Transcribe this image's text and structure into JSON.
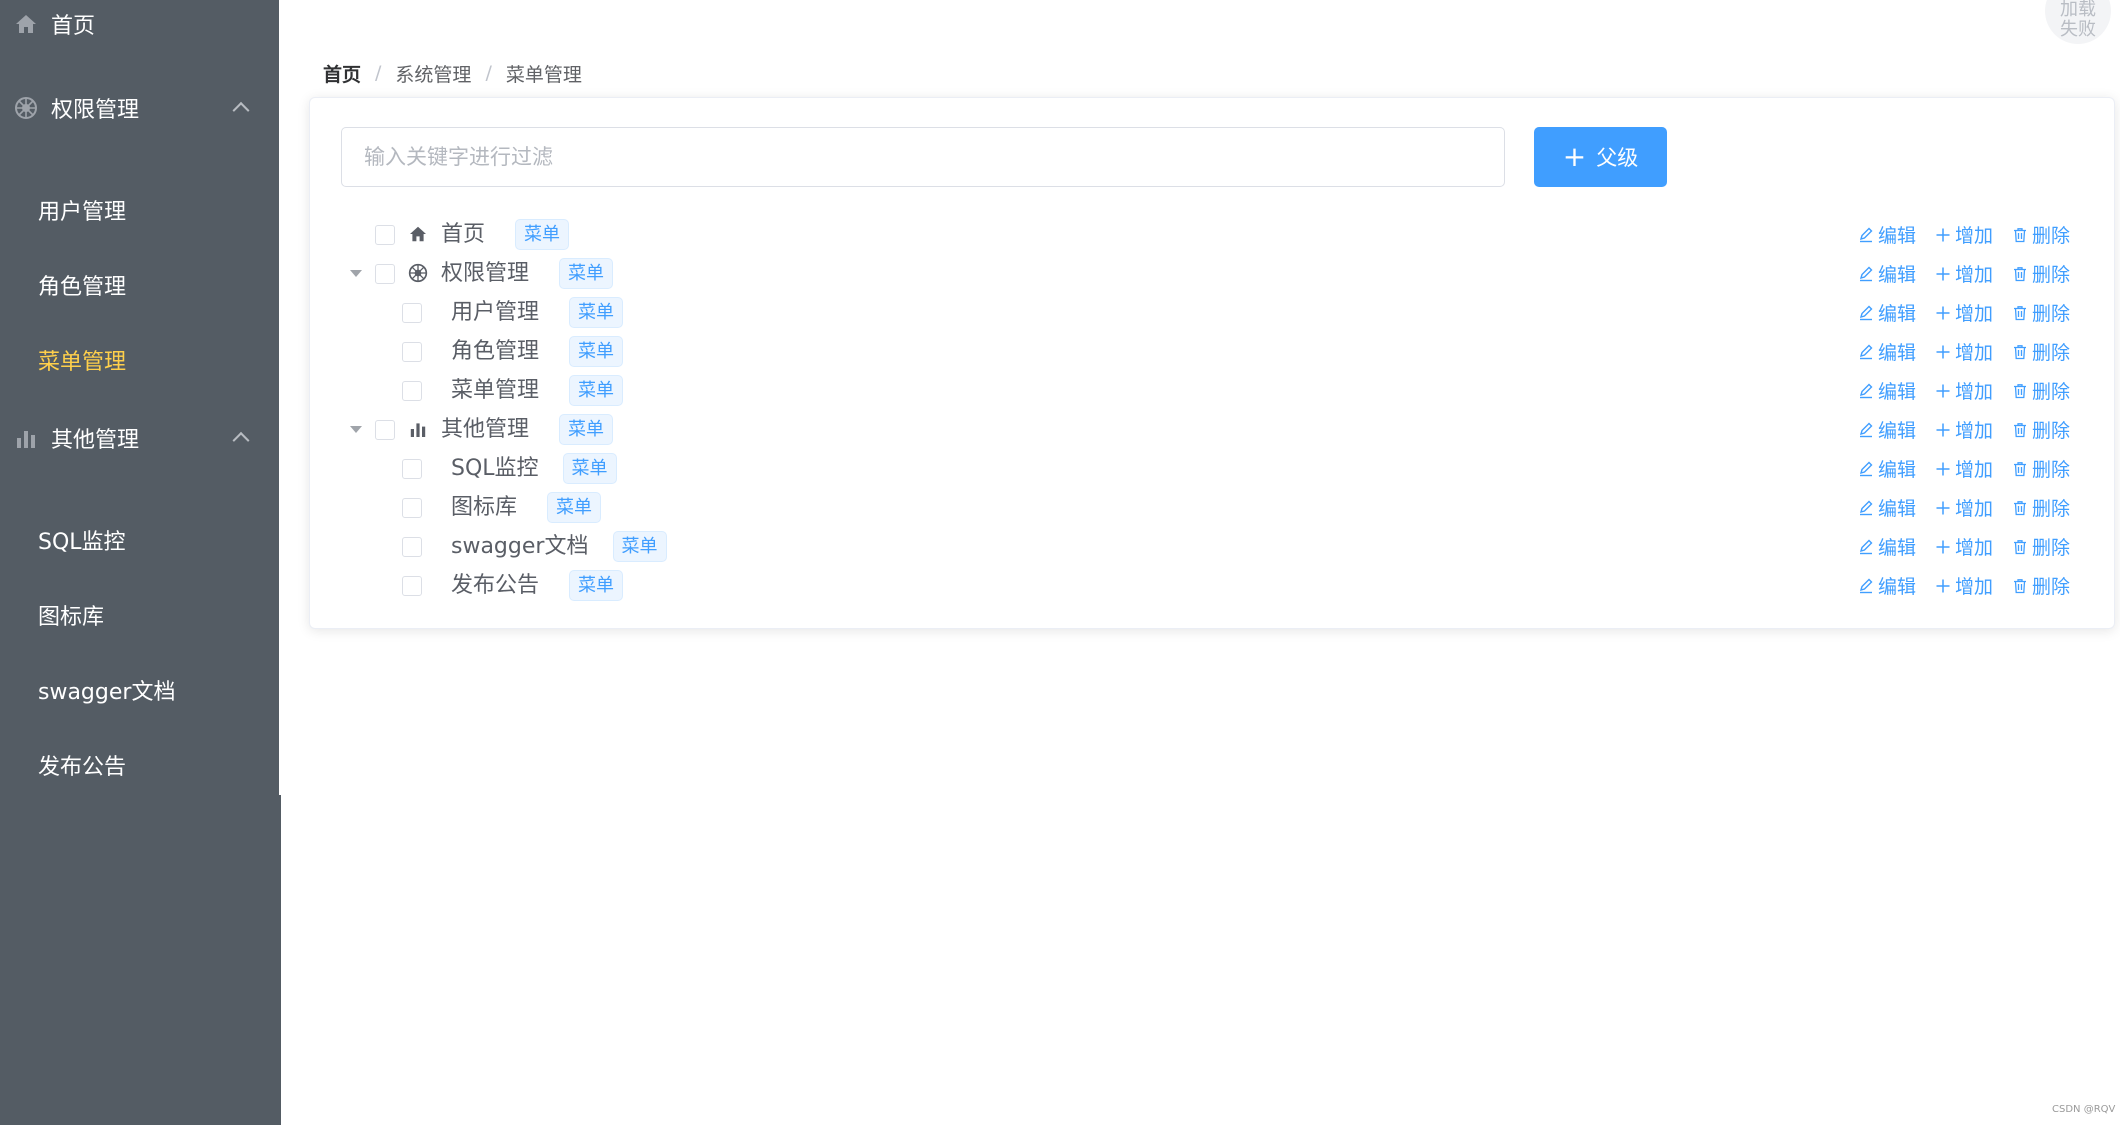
{
  "sidebar": {
    "items": [
      {
        "label": "首页",
        "icon": "home-icon"
      },
      {
        "label": "权限管理",
        "icon": "dharma-wheel-icon"
      },
      {
        "label": "用户管理"
      },
      {
        "label": "角色管理"
      },
      {
        "label": "菜单管理",
        "active": true
      },
      {
        "label": "其他管理",
        "icon": "bar-chart-icon"
      },
      {
        "label": "SQL监控"
      },
      {
        "label": "图标库"
      },
      {
        "label": "swagger文档"
      },
      {
        "label": "发布公告"
      }
    ],
    "background": "#545c64",
    "active_color": "#ffd04b"
  },
  "avatar": {
    "text": "加载失败"
  },
  "breadcrumb": [
    "首页",
    "系统管理",
    "菜单管理"
  ],
  "filter": {
    "placeholder": "输入关键字进行过滤",
    "value": ""
  },
  "add_parent_button": {
    "label": "父级",
    "icon": "plus-icon"
  },
  "tree": {
    "tag_label": "菜单",
    "nodes": [
      {
        "label": "首页",
        "level": 0,
        "icon": "home-icon"
      },
      {
        "label": "权限管理",
        "level": 0,
        "icon": "dharma-wheel-icon",
        "expanded": true
      },
      {
        "label": "用户管理",
        "level": 1
      },
      {
        "label": "角色管理",
        "level": 1
      },
      {
        "label": "菜单管理",
        "level": 1
      },
      {
        "label": "其他管理",
        "level": 0,
        "icon": "bar-chart-icon",
        "expanded": true
      },
      {
        "label": "SQL监控",
        "level": 1
      },
      {
        "label": "图标库",
        "level": 1
      },
      {
        "label": "swagger文档",
        "level": 1
      },
      {
        "label": "发布公告",
        "level": 1
      }
    ]
  },
  "row_actions": {
    "edit": "编辑",
    "add": "增加",
    "delete": "删除"
  },
  "accent_color": "#409eff",
  "watermark": "CSDN @RQV"
}
